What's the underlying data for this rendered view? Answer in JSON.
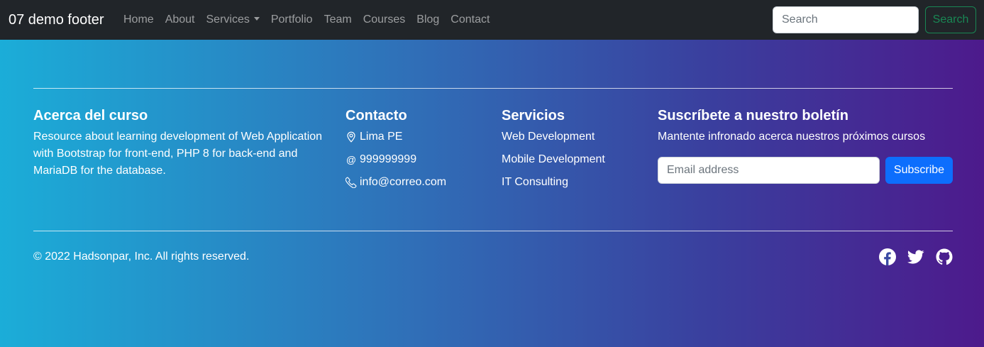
{
  "navbar": {
    "brand": "07 demo footer",
    "links": [
      "Home",
      "About",
      "Services",
      "Portfolio",
      "Team",
      "Courses",
      "Blog",
      "Contact"
    ],
    "search_placeholder": "Search",
    "search_button": "Search"
  },
  "footer": {
    "about": {
      "title": "Acerca del curso",
      "text": "Resource about learning development of Web Application with Bootstrap for front-end, PHP 8 for back-end and MariaDB for the database."
    },
    "contact": {
      "title": "Contacto",
      "items": [
        {
          "icon": "geo-alt-icon",
          "text": "Lima PE"
        },
        {
          "icon": "at-icon",
          "text": "999999999"
        },
        {
          "icon": "phone-icon",
          "text": "info@correo.com"
        }
      ]
    },
    "services": {
      "title": "Servicios",
      "items": [
        "Web Development",
        "Mobile Development",
        "IT Consulting"
      ]
    },
    "newsletter": {
      "title": "Suscríbete a nuestro boletín",
      "text": "Mantente infronado acerca nuestros próximos cursos",
      "email_placeholder": "Email address",
      "button": "Subscribe"
    },
    "copyright": "© 2022 Hadsonpar, Inc. All rights reserved.",
    "social": [
      "facebook-icon",
      "twitter-icon",
      "github-icon"
    ]
  },
  "colors": {
    "navbar_bg": "#212529",
    "gradient_start": "#1badd8",
    "gradient_end": "#4d1a8c",
    "success": "#198754",
    "primary": "#0d6efd"
  }
}
